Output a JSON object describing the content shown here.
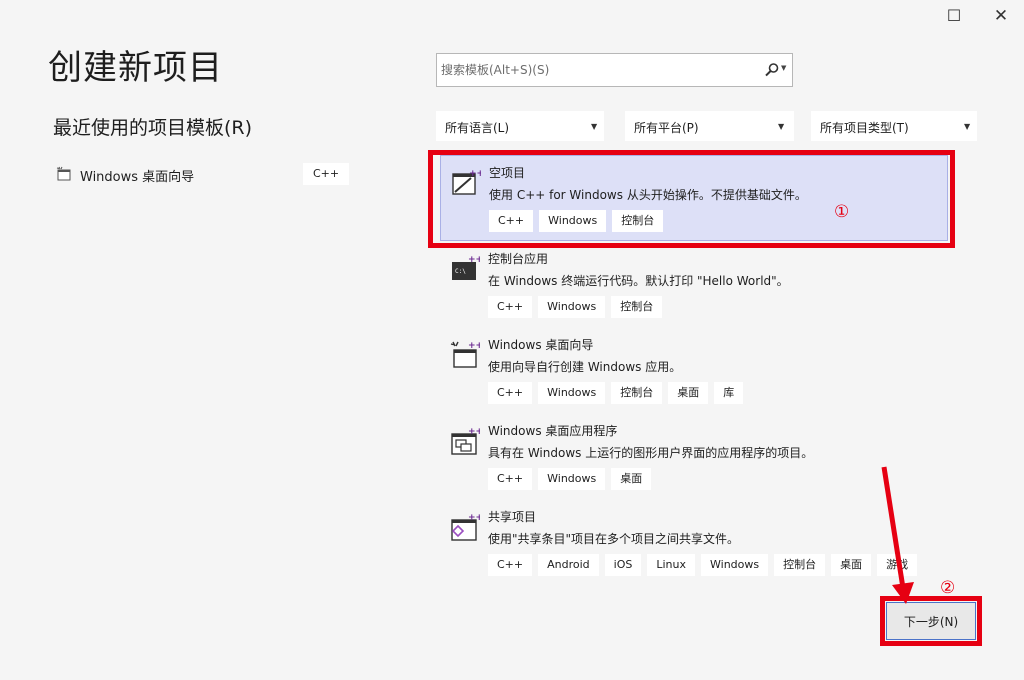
{
  "window": {
    "maximize_glyph": "☐",
    "close_glyph": "✕"
  },
  "page_title": "创建新项目",
  "recent": {
    "title": "最近使用的项目模板(R)",
    "items": [
      {
        "label": "Windows 桌面向导",
        "tag": "C++",
        "icon": "windows-desktop-wizard-icon"
      }
    ]
  },
  "search": {
    "placeholder": "搜索模板(Alt+S)(S)",
    "value": ""
  },
  "filters": {
    "language": "所有语言(L)",
    "platform": "所有平台(P)",
    "project_type": "所有项目类型(T)"
  },
  "templates": [
    {
      "title": "空项目",
      "desc": "使用 C++ for Windows 从头开始操作。不提供基础文件。",
      "tags": [
        "C++",
        "Windows",
        "控制台"
      ],
      "icon": "empty-project-icon",
      "selected": true
    },
    {
      "title": "控制台应用",
      "desc": "在 Windows 终端运行代码。默认打印 \"Hello World\"。",
      "tags": [
        "C++",
        "Windows",
        "控制台"
      ],
      "icon": "console-app-icon",
      "selected": false
    },
    {
      "title": "Windows 桌面向导",
      "desc": "使用向导自行创建 Windows 应用。",
      "tags": [
        "C++",
        "Windows",
        "控制台",
        "桌面",
        "库"
      ],
      "icon": "desktop-wizard-icon",
      "selected": false
    },
    {
      "title": "Windows 桌面应用程序",
      "desc": "具有在 Windows 上运行的图形用户界面的应用程序的项目。",
      "tags": [
        "C++",
        "Windows",
        "桌面"
      ],
      "icon": "desktop-app-icon",
      "selected": false
    },
    {
      "title": "共享项目",
      "desc": "使用\"共享条目\"项目在多个项目之间共享文件。",
      "tags": [
        "C++",
        "Android",
        "iOS",
        "Linux",
        "Windows",
        "控制台",
        "桌面",
        "游戏"
      ],
      "icon": "shared-project-icon",
      "selected": false
    }
  ],
  "annotations": {
    "num1": "①",
    "num2": "②",
    "color": "#e60012"
  },
  "next_button": "下一步(N)",
  "colors": {
    "accent": "#6c2c91",
    "selected_bg": "#dde0f7",
    "annotation": "#e60012"
  }
}
